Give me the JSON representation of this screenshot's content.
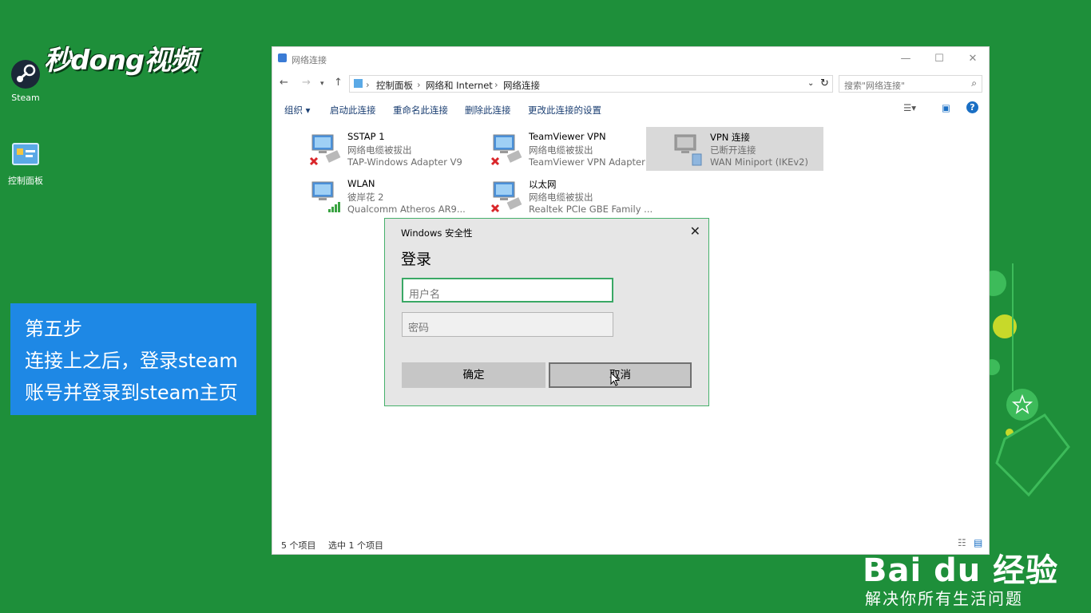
{
  "desktop": {
    "icons": [
      {
        "label": "Steam"
      },
      {
        "label": "控制面板"
      }
    ],
    "brand": "秒dong视频"
  },
  "step_box": {
    "lines": [
      "第五步",
      "连接上之后，登录steam",
      "账号并登录到steam主页"
    ]
  },
  "window": {
    "title": "网络连接",
    "breadcrumb": [
      "控制面板",
      "网络和 Internet",
      "网络连接"
    ],
    "search_placeholder": "搜索\"网络连接\"",
    "commands": [
      "组织 ▾",
      "启动此连接",
      "重命名此连接",
      "删除此连接",
      "更改此连接的设置"
    ],
    "connections": [
      {
        "name": "SSTAP 1",
        "status": "网络电缆被拔出",
        "adapter": "TAP-Windows Adapter V9",
        "state": "disconnected",
        "selected": false
      },
      {
        "name": "TeamViewer VPN",
        "status": "网络电缆被拔出",
        "adapter": "TeamViewer VPN Adapter",
        "state": "disconnected",
        "selected": false
      },
      {
        "name": "VPN 连接",
        "status": "已断开连接",
        "adapter": "WAN Miniport (IKEv2)",
        "state": "vpn",
        "selected": true
      },
      {
        "name": "WLAN",
        "status": "彼岸花 2",
        "adapter": "Qualcomm Atheros AR9...",
        "state": "wifi",
        "selected": false
      },
      {
        "name": "以太网",
        "status": "网络电缆被拔出",
        "adapter": "Realtek PCIe GBE Family ...",
        "state": "disconnected",
        "selected": false
      }
    ],
    "status_count": "5 个项目",
    "status_selected": "选中 1 个项目"
  },
  "dialog": {
    "title": "Windows 安全性",
    "heading": "登录",
    "username_placeholder": "用户名",
    "password_placeholder": "密码",
    "ok_label": "确定",
    "cancel_label": "取消"
  },
  "watermark": {
    "logo": "Bai du 经验",
    "slogan": "解决你所有生活问题"
  },
  "colors": {
    "desktop_bg": "#1e8f3a",
    "step_bg": "#1e88e5",
    "dialog_border": "#46b06b",
    "selected_item": "#d9d9d9"
  }
}
